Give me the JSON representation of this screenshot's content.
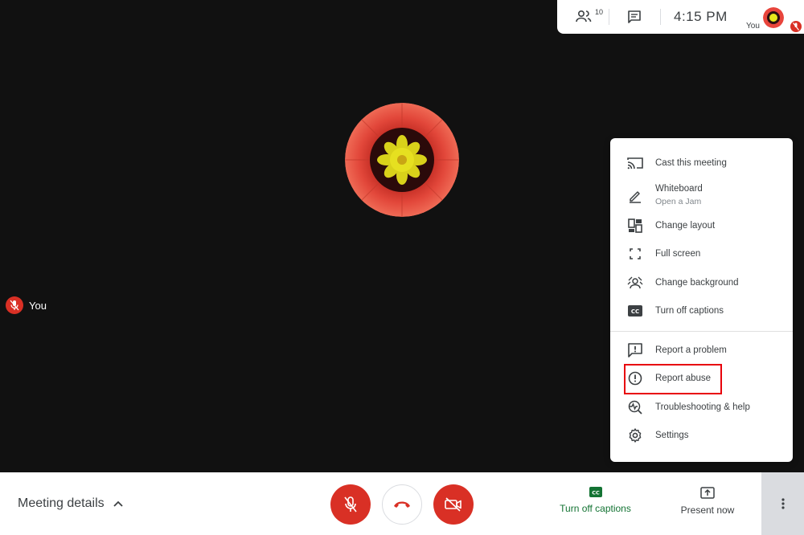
{
  "topbar": {
    "participant_count": "10",
    "clock": "4:15 PM",
    "self_label": "You"
  },
  "tile": {
    "self_label": "You"
  },
  "menu": {
    "items": [
      {
        "label": "Cast this meeting",
        "icon": "cast-icon"
      },
      {
        "label": "Whiteboard",
        "sublabel": "Open a Jam",
        "icon": "pen-icon"
      },
      {
        "label": "Change layout",
        "icon": "layout-icon"
      },
      {
        "label": "Full screen",
        "icon": "fullscreen-icon"
      },
      {
        "label": "Change background",
        "icon": "background-icon"
      },
      {
        "label": "Turn off captions",
        "icon": "captions-icon"
      },
      {
        "label": "Report a problem",
        "icon": "feedback-icon"
      },
      {
        "label": "Report abuse",
        "icon": "alert-icon"
      },
      {
        "label": "Troubleshooting & help",
        "icon": "troubleshoot-icon"
      },
      {
        "label": "Settings",
        "icon": "gear-icon"
      }
    ]
  },
  "bottombar": {
    "meeting_details": "Meeting details",
    "captions_label": "Turn off captions",
    "present_label": "Present now"
  },
  "colors": {
    "danger": "#d93025",
    "accent_green": "#137333",
    "highlight": "#e8000b"
  }
}
